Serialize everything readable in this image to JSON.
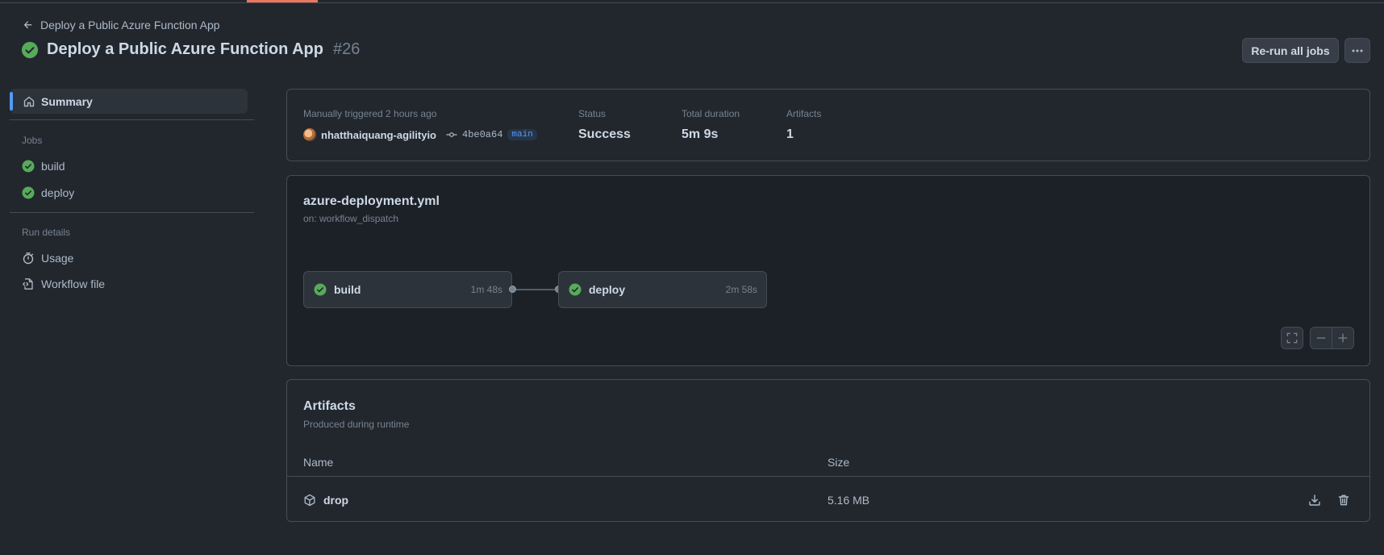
{
  "back_link": {
    "label": "Deploy a Public Azure Function App"
  },
  "header": {
    "title": "Deploy a Public Azure Function App",
    "run_number": "#26",
    "rerun_label": "Re-run all jobs"
  },
  "sidebar": {
    "summary_label": "Summary",
    "jobs_heading": "Jobs",
    "jobs": [
      {
        "label": "build",
        "status": "success"
      },
      {
        "label": "deploy",
        "status": "success"
      }
    ],
    "run_details_heading": "Run details",
    "run_details": [
      {
        "label": "Usage",
        "icon": "stopwatch-icon"
      },
      {
        "label": "Workflow file",
        "icon": "file-code-icon"
      }
    ]
  },
  "summary": {
    "trigger_text": "Manually triggered 2 hours ago",
    "actor": "nhatthaiquang-agilityio",
    "commit_sha": "4be0a64",
    "branch": "main",
    "status_label": "Status",
    "status_value": "Success",
    "duration_label": "Total duration",
    "duration_value": "5m 9s",
    "artifacts_label": "Artifacts",
    "artifacts_value": "1"
  },
  "workflow_graph": {
    "file_name": "azure-deployment.yml",
    "trigger": "on: workflow_dispatch",
    "jobs": [
      {
        "name": "build",
        "duration": "1m 48s",
        "status": "success"
      },
      {
        "name": "deploy",
        "duration": "2m 58s",
        "status": "success"
      }
    ]
  },
  "artifacts": {
    "title": "Artifacts",
    "subtitle": "Produced during runtime",
    "columns": {
      "name": "Name",
      "size": "Size"
    },
    "rows": [
      {
        "name": "drop",
        "size": "5.16 MB"
      }
    ]
  },
  "colors": {
    "background": "#22272e",
    "success": "#57ab5a",
    "accent": "#539bf5",
    "border": "#444c56"
  }
}
